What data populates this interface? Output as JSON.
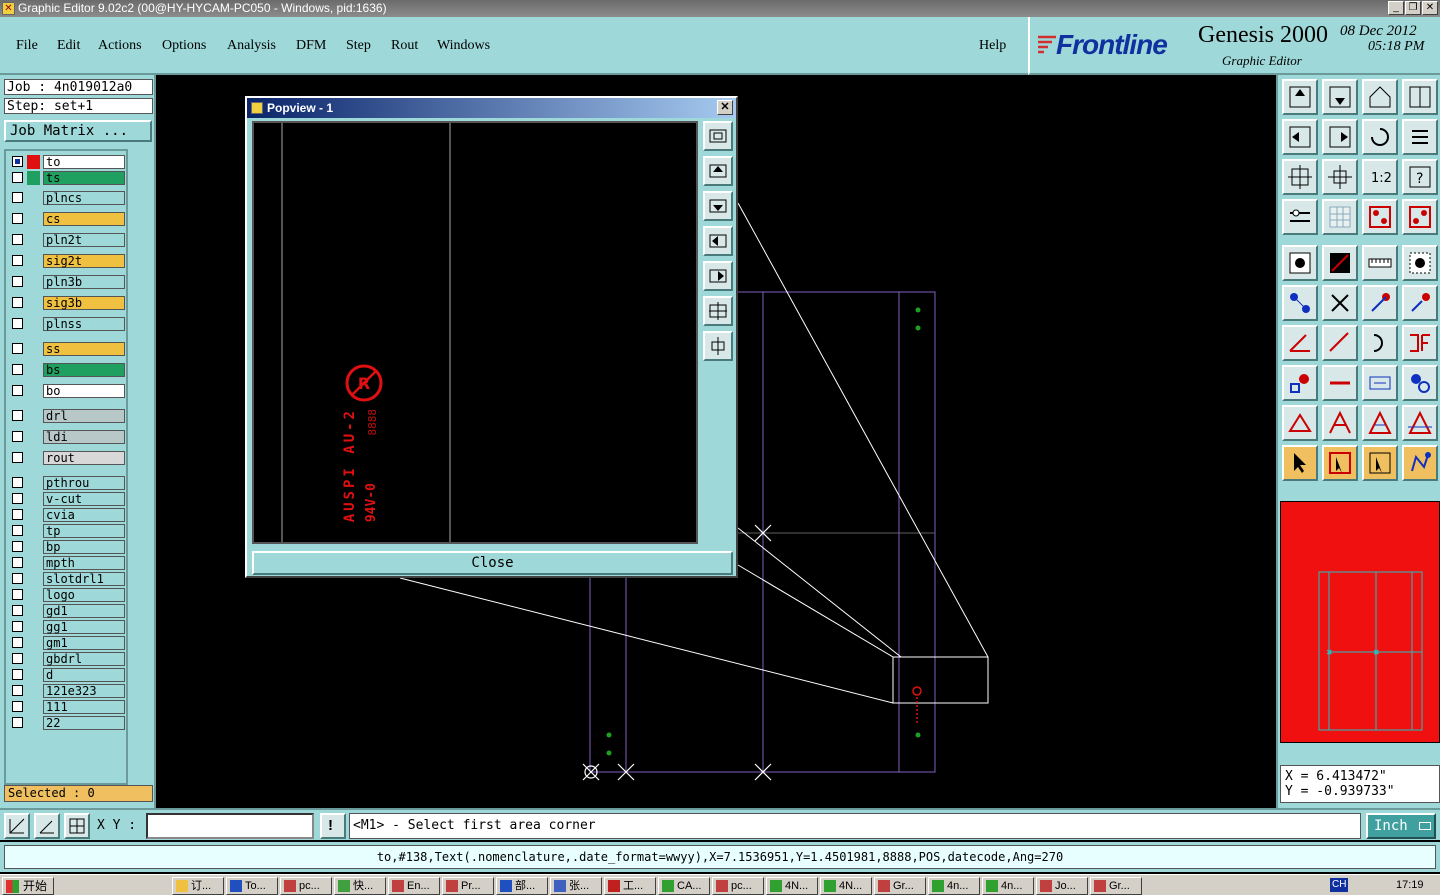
{
  "window": {
    "title": "Graphic Editor 9.02c2 (00@HY-HYCAM-PC050 - Windows, pid:1636)"
  },
  "menu": [
    "File",
    "Edit",
    "Actions",
    "Options",
    "Analysis",
    "DFM",
    "Step",
    "Rout",
    "Windows"
  ],
  "help": "Help",
  "brand": {
    "logo": "Frontline",
    "product": "Genesis 2000",
    "subtitle": "Graphic Editor",
    "date": "08 Dec 2012",
    "time": "05:18 PM"
  },
  "job": "Job : 4n019012a0",
  "step": "Step: set+1",
  "job_matrix": "Job Matrix ...",
  "layers": [
    {
      "name": "to",
      "color": "#ffffff",
      "swatch": "#e01010"
    },
    {
      "name": "ts",
      "color": "#20a060",
      "swatch": "#20a060"
    },
    {
      "name": "plncs",
      "color": "#9ed8d8",
      "swatch": ""
    },
    {
      "name": "cs",
      "color": "#f0c040",
      "swatch": ""
    },
    {
      "name": "pln2t",
      "color": "#9ed8d8",
      "swatch": ""
    },
    {
      "name": "sig2t",
      "color": "#f0c040",
      "swatch": ""
    },
    {
      "name": "pln3b",
      "color": "#9ed8d8",
      "swatch": ""
    },
    {
      "name": "sig3b",
      "color": "#f0c040",
      "swatch": ""
    },
    {
      "name": "plnss",
      "color": "#9ed8d8",
      "swatch": ""
    },
    {
      "name": "ss",
      "color": "#f0c040",
      "swatch": ""
    },
    {
      "name": "bs",
      "color": "#20a060",
      "swatch": ""
    },
    {
      "name": "bo",
      "color": "#ffffff",
      "swatch": ""
    },
    {
      "name": "drl",
      "color": "#b8c8c8",
      "swatch": ""
    },
    {
      "name": "ldi",
      "color": "#b8c8c8",
      "swatch": ""
    },
    {
      "name": "rout",
      "color": "#d8d8d8",
      "swatch": ""
    },
    {
      "name": "pthrou",
      "color": "#9ed8d8",
      "swatch": ""
    },
    {
      "name": "v-cut",
      "color": "#9ed8d8",
      "swatch": ""
    },
    {
      "name": "cvia",
      "color": "#9ed8d8",
      "swatch": ""
    },
    {
      "name": "tp",
      "color": "#9ed8d8",
      "swatch": ""
    },
    {
      "name": "bp",
      "color": "#9ed8d8",
      "swatch": ""
    },
    {
      "name": "mpth",
      "color": "#9ed8d8",
      "swatch": ""
    },
    {
      "name": "slotdrl1",
      "color": "#9ed8d8",
      "swatch": ""
    },
    {
      "name": "logo",
      "color": "#9ed8d8",
      "swatch": ""
    },
    {
      "name": "gd1",
      "color": "#9ed8d8",
      "swatch": ""
    },
    {
      "name": "gg1",
      "color": "#9ed8d8",
      "swatch": ""
    },
    {
      "name": "gm1",
      "color": "#9ed8d8",
      "swatch": ""
    },
    {
      "name": "gbdrl",
      "color": "#9ed8d8",
      "swatch": ""
    },
    {
      "name": "d",
      "color": "#9ed8d8",
      "swatch": ""
    },
    {
      "name": "121e323",
      "color": "#9ed8d8",
      "swatch": ""
    },
    {
      "name": "111",
      "color": "#9ed8d8",
      "swatch": ""
    },
    {
      "name": "22",
      "color": "#9ed8d8",
      "swatch": ""
    }
  ],
  "selected": "Selected : 0",
  "coords": {
    "x": "X =  6.413472\"",
    "y": "Y = -0.939733\""
  },
  "cmd": {
    "xy_label": "X Y :",
    "xy_value": "",
    "prompt": "<M1> - Select first area corner",
    "units": "Inch"
  },
  "status": "to,#138,Text(.nomenclature,.date_format=wwyy),X=7.1536951,Y=1.4501981,8888,POS,datecode,Ang=270",
  "popview": {
    "title": "Popview - 1",
    "close": "Close",
    "text_line1": "AUSPI AU-2",
    "text_line2": "94V-0",
    "datecode": "8888"
  },
  "taskbar": {
    "start": "开始",
    "clock": "17:19",
    "lang": "CH",
    "tasks": [
      "订...",
      "To...",
      "pc...",
      "快...",
      "En...",
      "Pr...",
      "部...",
      "张...",
      "工...",
      "CA...",
      "pc...",
      "4N...",
      "4N...",
      "Gr...",
      "4n...",
      "4n...",
      "Jo...",
      "Gr..."
    ]
  }
}
